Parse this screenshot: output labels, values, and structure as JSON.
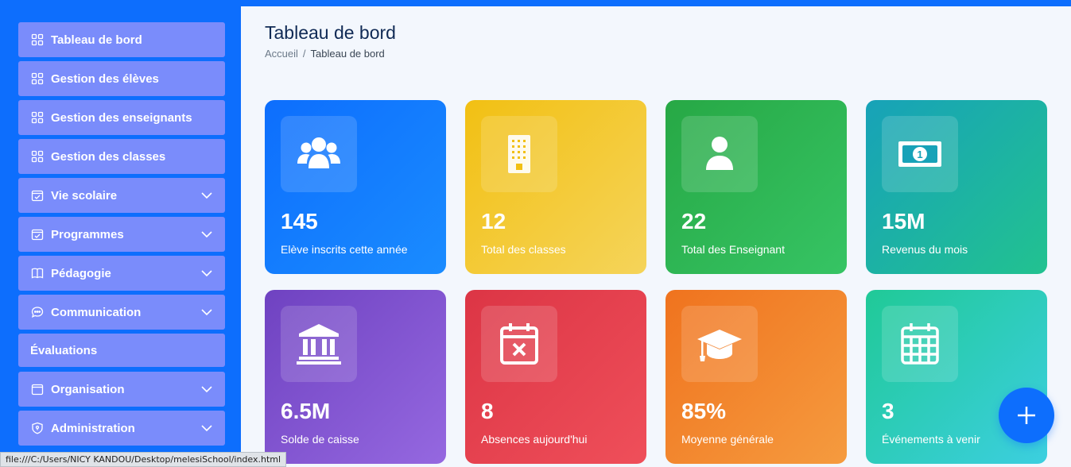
{
  "sidebar": {
    "items": [
      {
        "label": "Tableau de bord",
        "icon": "grid-icon"
      },
      {
        "label": "Gestion des élèves",
        "icon": "grid-icon"
      },
      {
        "label": "Gestion des enseignants",
        "icon": "grid-icon"
      },
      {
        "label": "Gestion des classes",
        "icon": "grid-icon"
      },
      {
        "label": "Vie scolaire",
        "icon": "calendar-check-icon",
        "expandable": true
      },
      {
        "label": "Programmes",
        "icon": "calendar-check-icon",
        "expandable": true
      },
      {
        "label": "Pédagogie",
        "icon": "book-icon",
        "expandable": true
      },
      {
        "label": "Communication",
        "icon": "chat-icon",
        "expandable": true
      },
      {
        "label": "Évaluations",
        "icon": ""
      },
      {
        "label": "Organisation",
        "icon": "calendar-icon",
        "expandable": true
      },
      {
        "label": "Administration",
        "icon": "shield-icon",
        "expandable": true
      }
    ]
  },
  "header": {
    "title": "Tableau de bord",
    "breadcrumb": {
      "home": "Accueil",
      "separator": "/",
      "current": "Tableau de bord"
    }
  },
  "cards": [
    {
      "value": "145",
      "label": "Elève inscrits cette année",
      "icon": "users-icon",
      "color": "#0d6efd"
    },
    {
      "value": "12",
      "label": "Total des classes",
      "icon": "building-icon",
      "color": "#f2c013"
    },
    {
      "value": "22",
      "label": "Total des Enseignant",
      "icon": "person-icon",
      "color": "#27a845"
    },
    {
      "value": "15M",
      "label": "Revenus du mois",
      "icon": "money-icon",
      "color": "#17a2b8"
    },
    {
      "value": "6.5M",
      "label": "Solde de caisse",
      "icon": "bank-icon",
      "color": "#6f42c1"
    },
    {
      "value": "8",
      "label": "Absences aujourd'hui",
      "icon": "calendar-x-icon",
      "color": "#dc3545"
    },
    {
      "value": "85%",
      "label": "Moyenne générale",
      "icon": "graduation-cap-icon",
      "color": "#f0731e"
    },
    {
      "value": "3",
      "label": "Événements à venir",
      "icon": "calendar-grid-icon",
      "color": "#20c997"
    }
  ],
  "fab": {
    "icon": "plus-icon"
  },
  "statusbar": {
    "url": "file:///C:/Users/NICY KANDOU/Desktop/melesiSchool/index.html"
  }
}
